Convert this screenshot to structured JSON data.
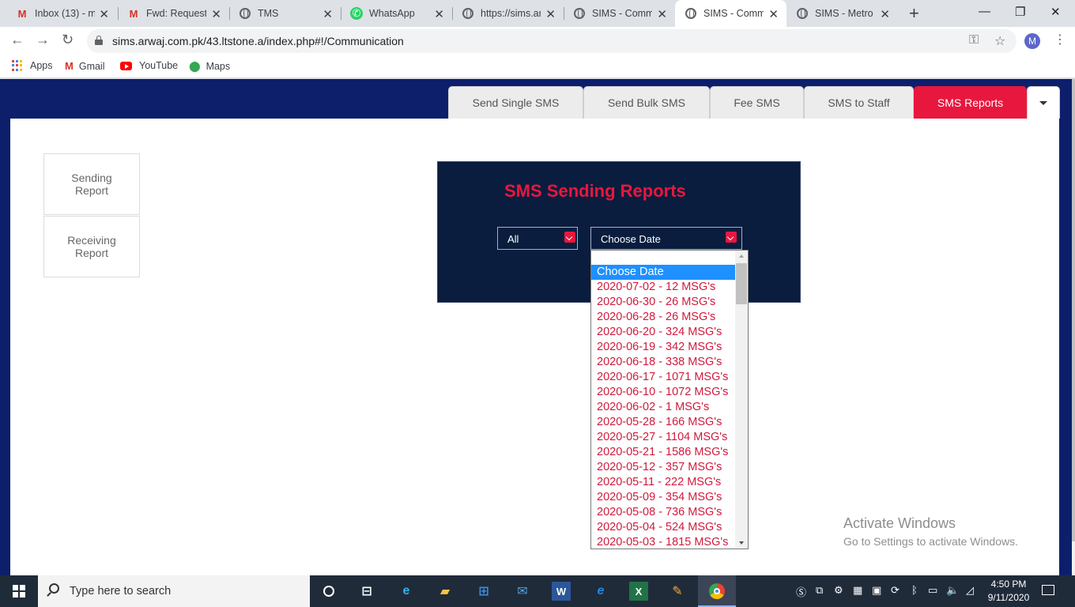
{
  "browser": {
    "tabs": [
      {
        "title": "Inbox (13) - m",
        "icon": "gmail-icon"
      },
      {
        "title": "Fwd: Request f",
        "icon": "gmail-icon"
      },
      {
        "title": "TMS",
        "icon": "globe-icon"
      },
      {
        "title": "WhatsApp",
        "icon": "whatsapp-icon"
      },
      {
        "title": "https://sims.ar",
        "icon": "globe-icon"
      },
      {
        "title": "SIMS - Comm",
        "icon": "globe-icon"
      },
      {
        "title": "SIMS - Comm",
        "icon": "globe-icon",
        "active": true
      },
      {
        "title": "SIMS - Metro l",
        "icon": "globe-icon"
      }
    ],
    "url": "sims.arwaj.com.pk/43.ltstone.a/index.php#!/Communication",
    "profile_initial": "M",
    "bookmarks": [
      "Apps",
      "Gmail",
      "YouTube",
      "Maps"
    ]
  },
  "nav": {
    "tabs": [
      "Send Single SMS",
      "Send Bulk SMS",
      "Fee SMS",
      "SMS to Staff",
      "SMS Reports"
    ],
    "active_index": 4
  },
  "sidebar": {
    "sending": "Sending Report",
    "receiving": "Receiving Report"
  },
  "panel": {
    "title": "SMS Sending Reports",
    "filter_value": "All",
    "date_value": "Choose Date"
  },
  "dropdown": {
    "options": [
      "Choose Date",
      "2020-07-02 - 12 MSG's",
      "2020-06-30 - 26 MSG's",
      "2020-06-28 - 26 MSG's",
      "2020-06-20 - 324 MSG's",
      "2020-06-19 - 342 MSG's",
      "2020-06-18 - 338 MSG's",
      "2020-06-17 - 1071 MSG's",
      "2020-06-10 - 1072 MSG's",
      "2020-06-02 - 1 MSG's",
      "2020-05-28 - 166 MSG's",
      "2020-05-27 - 1104 MSG's",
      "2020-05-21 - 1586 MSG's",
      "2020-05-12 - 357 MSG's",
      "2020-05-11 - 222 MSG's",
      "2020-05-09 - 354 MSG's",
      "2020-05-08 - 736 MSG's",
      "2020-05-04 - 524 MSG's",
      "2020-05-03 - 1815 MSG's"
    ],
    "selected_index": 0
  },
  "watermark": {
    "line1": "Activate Windows",
    "line2": "Go to Settings to activate Windows."
  },
  "taskbar": {
    "search_placeholder": "Type here to search",
    "time": "4:50 PM",
    "date": "9/11/2020"
  },
  "colors": {
    "accent": "#e8173e",
    "page_band": "#0d1f6b",
    "panel_bg": "#0a1d3e",
    "selected_option": "#1e90ff"
  }
}
